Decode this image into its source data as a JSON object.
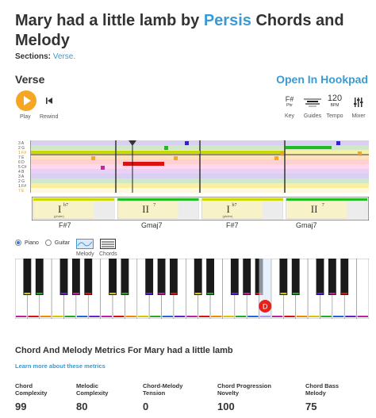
{
  "title": {
    "prefix": "Mary had a little lamb by ",
    "artist": "Persis",
    "suffix": " Chords and Melody"
  },
  "sections": {
    "label": "Sections:",
    "items": [
      "Verse."
    ]
  },
  "section_name": "Verse",
  "open_hookpad": "Open In Hookpad",
  "controls": {
    "play": "Play",
    "rewind": "Rewind"
  },
  "tools": {
    "key": {
      "icon": "F#",
      "sub": "Phr",
      "label": "Key"
    },
    "guides": {
      "label": "Guides"
    },
    "tempo": {
      "value": "120",
      "unit": "BPM",
      "label": "Tempo"
    },
    "mixer": {
      "label": "Mixer"
    }
  },
  "row_labels": [
    "3",
    "2",
    "1",
    "7",
    "6",
    "5",
    "4",
    "3",
    "2",
    "1",
    "7"
  ],
  "row_labels_sub": [
    "A",
    "G",
    "F#",
    "E",
    "D",
    "C#",
    "B",
    "A",
    "G",
    "F#",
    "E"
  ],
  "chords": [
    {
      "numeral": "I",
      "sup": "b7",
      "sub": "(phdm)",
      "name": "F#7"
    },
    {
      "numeral": "II",
      "sup": "7",
      "sub": "",
      "name": "Gmaj7"
    },
    {
      "numeral": "I",
      "sup": "b7",
      "sub": "(phdm)",
      "name": "F#7"
    },
    {
      "numeral": "II",
      "sup": "7",
      "sub": "",
      "name": "Gmaj7"
    }
  ],
  "instrument": {
    "piano": "Piano",
    "guitar": "Guitar"
  },
  "view_toggle": {
    "melody": "Melody",
    "chords": "Chords"
  },
  "keyboard_marker": "D",
  "metrics": {
    "title": "Chord And Melody Metrics For Mary had a little lamb",
    "link": "Learn more about these metrics",
    "items": [
      {
        "label1": "Chord",
        "label2": "Complexity",
        "value": "99"
      },
      {
        "label1": "Melodic",
        "label2": "Complexity",
        "value": "80"
      },
      {
        "label1": "Chord-Melody",
        "label2": "Tension",
        "value": "0"
      },
      {
        "label1": "Chord Progression",
        "label2": "Novelty",
        "value": "100"
      },
      {
        "label1": "Chord Bass",
        "label2": "Melody",
        "value": "75"
      }
    ]
  },
  "colors": {
    "accent": "#3a9ad1",
    "play": "#f5a623",
    "melody": "#e8201a",
    "bass": "#22bb22",
    "marker": "#e8201a"
  }
}
